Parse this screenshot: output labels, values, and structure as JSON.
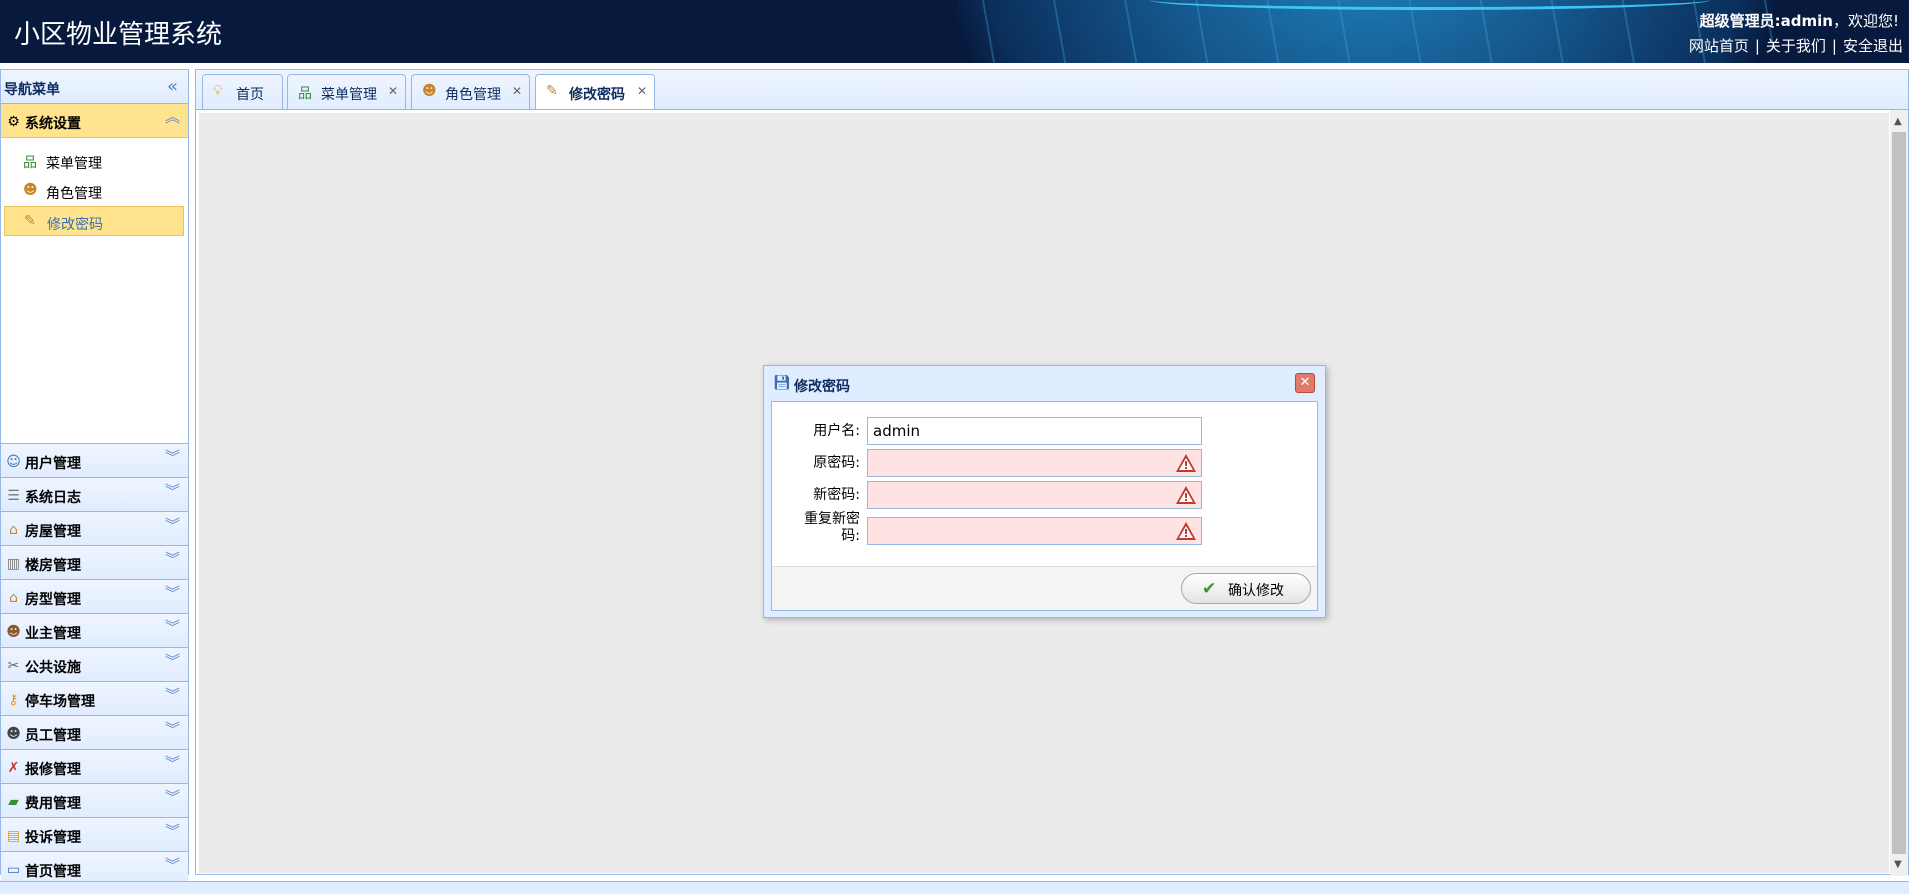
{
  "header": {
    "title": "小区物业管理系统",
    "greeting_prefix": "超级管理员:",
    "username": "admin",
    "greeting_suffix": "，欢迎您!",
    "links": [
      "网站首页",
      "关于我们",
      "安全退出"
    ],
    "link_separator": "|"
  },
  "sidebar": {
    "title": "导航菜单",
    "collapse_icon": "double-chevron-left-icon",
    "active_section": {
      "label": "系统设置",
      "icon": "gear-icon",
      "items": [
        {
          "label": "菜单管理",
          "icon": "sitemap-icon"
        },
        {
          "label": "角色管理",
          "icon": "users-icon"
        },
        {
          "label": "修改密码",
          "icon": "edit-password-icon",
          "selected": true
        }
      ]
    },
    "sections": [
      {
        "label": "用户管理",
        "icon": "user-icon"
      },
      {
        "label": "系统日志",
        "icon": "log-icon"
      },
      {
        "label": "房屋管理",
        "icon": "house-icon"
      },
      {
        "label": "楼房管理",
        "icon": "building-icon"
      },
      {
        "label": "房型管理",
        "icon": "house-type-icon"
      },
      {
        "label": "业主管理",
        "icon": "owner-icon"
      },
      {
        "label": "公共设施",
        "icon": "tools-icon"
      },
      {
        "label": "停车场管理",
        "icon": "keys-icon"
      },
      {
        "label": "员工管理",
        "icon": "staff-icon"
      },
      {
        "label": "报修管理",
        "icon": "repair-icon"
      },
      {
        "label": "费用管理",
        "icon": "money-icon"
      },
      {
        "label": "投诉管理",
        "icon": "folder-icon"
      },
      {
        "label": "首页管理",
        "icon": "homepage-icon"
      }
    ]
  },
  "tabs": [
    {
      "label": "首页",
      "icon": "lightbulb-icon",
      "closable": false,
      "active": false
    },
    {
      "label": "菜单管理",
      "icon": "sitemap-icon",
      "closable": true,
      "active": false
    },
    {
      "label": "角色管理",
      "icon": "users-icon",
      "closable": true,
      "active": false
    },
    {
      "label": "修改密码",
      "icon": "edit-password-icon",
      "closable": true,
      "active": true
    }
  ],
  "dialog": {
    "title": "修改密码",
    "icon": "save-icon",
    "fields": [
      {
        "label": "用户名:",
        "value": "admin",
        "error": false
      },
      {
        "label": "原密码:",
        "value": "",
        "error": true
      },
      {
        "label": "新密码:",
        "value": "",
        "error": true
      },
      {
        "label": "重复新密码:",
        "value": "",
        "error": true
      }
    ],
    "submit_label": "确认修改"
  },
  "colors": {
    "header_bg": "#071a3d",
    "panel_border": "#95b8e7",
    "active_highlight": "#ffe48d",
    "error_input_bg": "#ffe3e3"
  }
}
